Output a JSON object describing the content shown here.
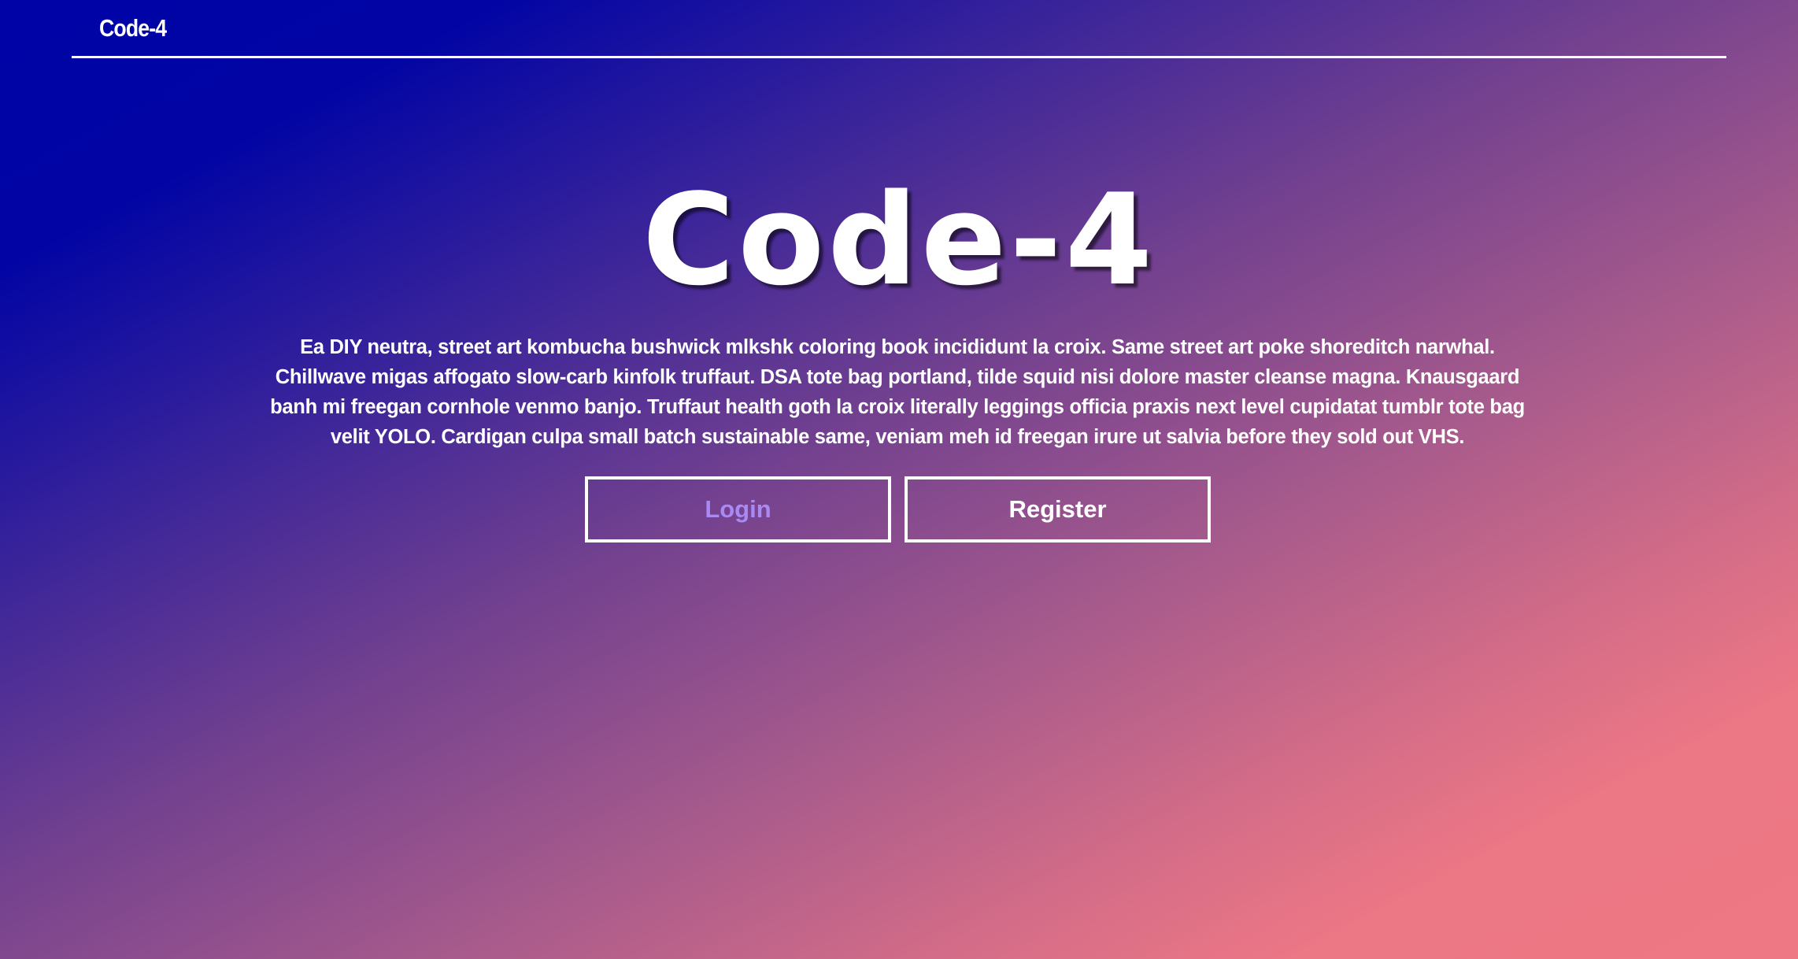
{
  "header": {
    "brand": "Code-4"
  },
  "hero": {
    "title": "Code-4",
    "description": "Ea DIY neutra, street art kombucha bushwick mlkshk coloring book incididunt la croix. Same street art poke shoreditch narwhal. Chillwave migas affogato slow-carb kinfolk truffaut. DSA tote bag portland, tilde squid nisi dolore master cleanse magna. Knausgaard banh mi freegan cornhole venmo banjo. Truffaut health goth la croix literally leggings officia praxis next level cupidatat tumblr tote bag velit YOLO. Cardigan culpa small batch sustainable same, veniam meh id freegan irure ut salvia before they sold out VHS."
  },
  "buttons": {
    "login": "Login",
    "register": "Register"
  },
  "colors": {
    "gradient_start": "#0004a6",
    "gradient_end": "#ee7884",
    "login_text": "#a98af5",
    "text": "#ffffff"
  }
}
